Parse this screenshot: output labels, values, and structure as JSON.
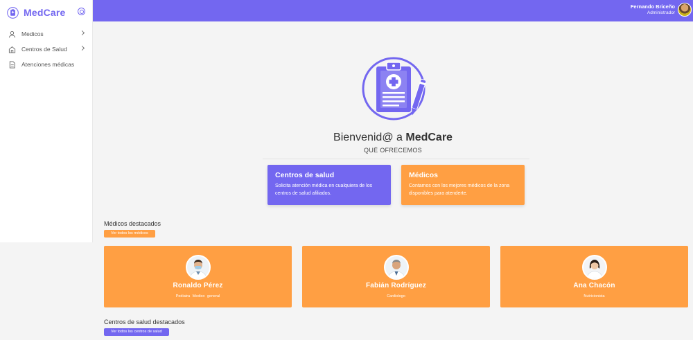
{
  "brand": {
    "name": "MedCare"
  },
  "sidebar": {
    "items": [
      {
        "label": "Medicos",
        "icon": "user-icon",
        "has_submenu": true
      },
      {
        "label": "Centros de Salud",
        "icon": "home-icon",
        "has_submenu": true
      },
      {
        "label": "Atenciones médicas",
        "icon": "document-icon",
        "has_submenu": false
      }
    ]
  },
  "topbar": {
    "user_name": "Fernando Briceño",
    "user_role": "Administrador"
  },
  "hero": {
    "greeting": "Bienvenid@ a ",
    "app_name": "MedCare",
    "subtitle": "QUÉ OFRECEMOS"
  },
  "offers": [
    {
      "title": "Centros de salud",
      "text": "Solicita atención médica en cualquiera de los centros de salud afiliados.",
      "color": "#7367f0"
    },
    {
      "title": "Médicos",
      "text": "Contamos con los mejores médicos de la zona disponibles para atenderte.",
      "color": "#ff9f43"
    }
  ],
  "featured_doctors": {
    "title": "Médicos destacados",
    "button": "Ver todos los médicos",
    "doctors": [
      {
        "name": "Ronaldo Pérez",
        "specialty": "Pediatra Medico general"
      },
      {
        "name": "Fabián Rodríguez",
        "specialty": "Cardiologo"
      },
      {
        "name": "Ana Chacón",
        "specialty": "Nutricionista"
      }
    ]
  },
  "featured_centers": {
    "title": "Centros de salud destacados",
    "button": "Ver todos los centros de salud"
  },
  "colors": {
    "primary": "#7367f0",
    "accent": "#ff9f43",
    "background": "#f4f4f4"
  }
}
